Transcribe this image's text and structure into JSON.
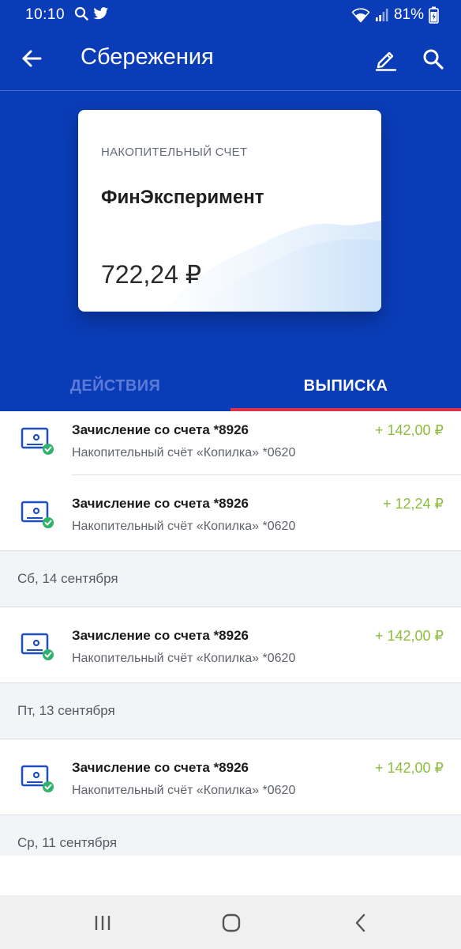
{
  "status_bar": {
    "time": "10:10",
    "left_icons": [
      "search-icon",
      "twitter-icon"
    ],
    "right_icons": [
      "wifi-icon",
      "signal-icon",
      "battery-icon"
    ],
    "battery": "81%"
  },
  "app_bar": {
    "title": "Сбережения",
    "back_icon": "arrow-left-icon",
    "edit_icon": "pencil-icon",
    "search_icon": "search-icon"
  },
  "card": {
    "type": "НАКОПИТЕЛЬНЫЙ СЧЕТ",
    "name": "ФинЭксперимент",
    "balance": "722,24 ₽"
  },
  "tabs": [
    {
      "label": "ДЕЙСТВИЯ",
      "active": false
    },
    {
      "label": "ВЫПИСКА",
      "active": true
    }
  ],
  "transactions_top": [
    {
      "title": "Зачисление со счета *8926",
      "subtitle": "Накопительный счёт «Копилка» *0620",
      "amount": "+ 142,00 ₽"
    },
    {
      "title": "Зачисление со счета *8926",
      "subtitle": "Накопительный счёт «Копилка» *0620",
      "amount": "+ 12,24 ₽"
    }
  ],
  "groups": [
    {
      "date": "Сб, 14 сентября",
      "transactions": [
        {
          "title": "Зачисление со счета *8926",
          "subtitle": "Накопительный счёт «Копилка» *0620",
          "amount": "+ 142,00 ₽"
        }
      ]
    },
    {
      "date": "Пт, 13 сентября",
      "transactions": [
        {
          "title": "Зачисление со счета *8926",
          "subtitle": "Накопительный счёт «Копилка» *0620",
          "amount": "+ 142,00 ₽"
        }
      ]
    },
    {
      "date": "Ср, 11 сентября",
      "transactions": []
    }
  ],
  "colors": {
    "brand_blue": "#0a3cb7",
    "income_green": "#8cbd3d",
    "tab_indicator": "#e0314b",
    "check_green": "#2fb36b"
  },
  "nav_bar": [
    "recents-icon",
    "home-icon",
    "back-icon"
  ]
}
